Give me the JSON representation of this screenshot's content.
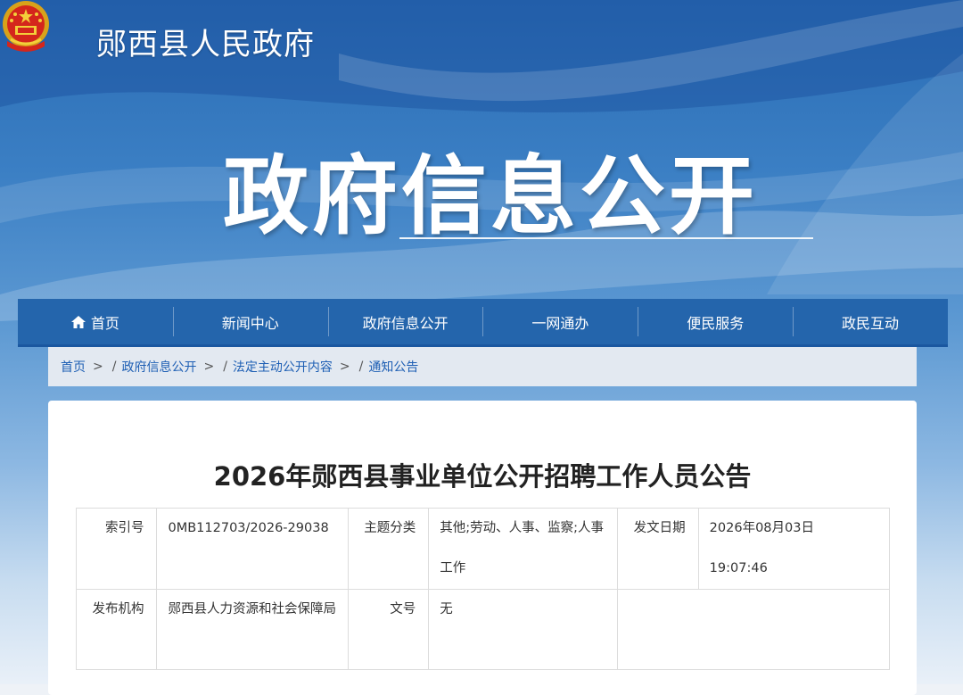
{
  "header": {
    "site_name": "郧西县人民政府",
    "banner_title": "政府信息公开",
    "emblem": "national-emblem"
  },
  "nav": {
    "items": [
      {
        "label": "首页",
        "icon": "home-icon"
      },
      {
        "label": "新闻中心"
      },
      {
        "label": "政府信息公开"
      },
      {
        "label": "一网通办"
      },
      {
        "label": "便民服务"
      },
      {
        "label": "政民互动"
      }
    ]
  },
  "breadcrumb": {
    "items": [
      "首页",
      "政府信息公开",
      "法定主动公开内容",
      "通知公告"
    ],
    "separator": ">",
    "slash": "/"
  },
  "article": {
    "title": "2026年郧西县事业单位公开招聘工作人员公告",
    "meta": {
      "index_label": "索引号",
      "index_value": "0MB112703/2026-29038",
      "subject_label": "主题分类",
      "subject_value": "其他;劳动、人事、监察;人事工作",
      "date_label": "发文日期",
      "date_value": "2026年08月03日 19:07:46",
      "org_label": "发布机构",
      "org_value": "郧西县人力资源和社会保障局",
      "docno_label": "文号",
      "docno_value": "无"
    }
  },
  "colors": {
    "nav_bg": "#2465ac",
    "link": "#1e5fb4",
    "breadcrumb_bg": "#e3e9f1"
  }
}
